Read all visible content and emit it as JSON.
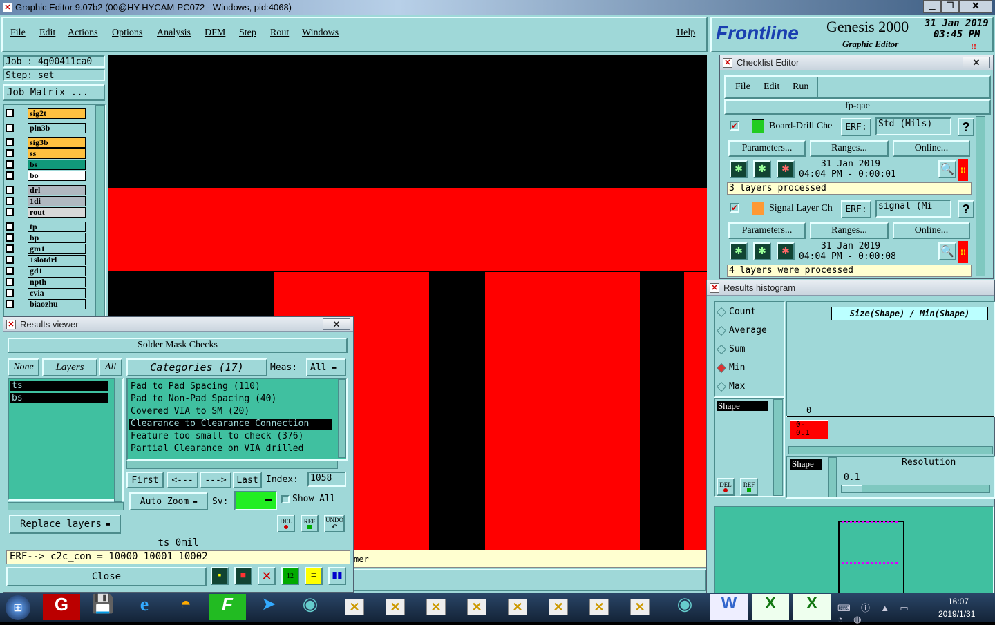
{
  "window": {
    "title": "Graphic Editor 9.07b2 (00@HY-HYCAM-PC072 - Windows, pid:4068)"
  },
  "menu": {
    "items": [
      "File",
      "Edit",
      "Actions",
      "Options",
      "Analysis",
      "DFM",
      "Step",
      "Rout",
      "Windows"
    ],
    "help": "Help"
  },
  "brand": {
    "logo": "Frontline",
    "product": "Genesis 2000",
    "subtitle": "Graphic Editor",
    "date": "31 Jan 2019",
    "time": "03:45 PM"
  },
  "job": {
    "job_label": "Job  : 4g00411ca0",
    "step_label": "Step: set",
    "matrix_button": "Job Matrix ..."
  },
  "layers": [
    {
      "name": "sig2t",
      "color": "#ffc040"
    },
    {
      "name": "pln3b",
      "color": "#9fd8d8"
    },
    {
      "name": "sig3b",
      "color": "#ffc040"
    },
    {
      "name": "ss",
      "color": "#ffc040"
    },
    {
      "name": "bs",
      "color": "#11997a"
    },
    {
      "name": "bo",
      "color": "#ffffff"
    },
    {
      "name": "drl",
      "color": "#b0b8c0"
    },
    {
      "name": "1di",
      "color": "#b0b8c0"
    },
    {
      "name": "rout",
      "color": "#d8d8d8"
    },
    {
      "name": "tp",
      "color": "#9fd8d8"
    },
    {
      "name": "bp",
      "color": "#9fd8d8"
    },
    {
      "name": "gm1",
      "color": "#9fd8d8"
    },
    {
      "name": "1slotdrl",
      "color": "#9fd8d8"
    },
    {
      "name": "gd1",
      "color": "#9fd8d8"
    },
    {
      "name": "npth",
      "color": "#9fd8d8"
    },
    {
      "name": "cvia",
      "color": "#9fd8d8"
    },
    {
      "name": "biaozhu",
      "color": "#9fd8d8"
    }
  ],
  "checklist": {
    "title": "Checklist Editor",
    "menu": [
      "File",
      "Edit",
      "Run"
    ],
    "name": "fp-qae",
    "checks": [
      {
        "name": "Board-Drill Che",
        "erf_label": "ERF:",
        "erf_value": "Std (Mils)",
        "help": "?",
        "params": "Parameters...",
        "ranges": "Ranges...",
        "online": "Online...",
        "date": "31 Jan 2019",
        "time": "04:04 PM - 0:00:01",
        "status": "3 layers processed"
      },
      {
        "name": "Signal Layer Ch",
        "erf_label": "ERF:",
        "erf_value": "signal (Mi",
        "help": "?",
        "params": "Parameters...",
        "ranges": "Ranges...",
        "online": "Online...",
        "date": "31 Jan 2019",
        "time": "04:04 PM - 0:00:08",
        "status": "4 layers were processed"
      }
    ]
  },
  "histogram": {
    "title": "Results histogram",
    "options": [
      "Count",
      "Average",
      "Sum",
      "Min",
      "Max"
    ],
    "selected": "Min",
    "header": "Size(Shape) / Min(Shape)",
    "zero": "0",
    "bin_label": "0-\n0.1",
    "list_item": "Shape",
    "shape_label": "Shape",
    "resolution_label": "Resolution",
    "resolution_value": "0.1",
    "del": "DEL",
    "ref": "REF"
  },
  "results": {
    "title": "Results viewer",
    "header": "Solder Mask Checks",
    "none_btn": "None",
    "layers_btn": "Layers",
    "all_btn": "All",
    "layers": [
      "ts",
      "bs"
    ],
    "categories_btn": "Categories (17)",
    "meas_label": "Meas:",
    "meas_value": "All",
    "categories": [
      "Pad to Pad Spacing (110)",
      "Pad to Non-Pad Spacing (40)",
      "Covered VIA to SM (20)",
      "Clearance to Clearance Connection",
      "Feature too small to check (376)",
      "Partial Clearance on VIA drilled"
    ],
    "selected_category": 3,
    "first": "First",
    "prev": "<---",
    "next": "--->",
    "last": "Last",
    "index_label": "Index:",
    "index_value": "1058",
    "zoom": "Auto Zoom",
    "sv_label": "Sv:",
    "show_all": "Show All",
    "replace": "Replace layers",
    "del": "DEL",
    "ref": "REF",
    "undo": "UNDO",
    "status": "ts 0mil",
    "erf": "ERF--> c2c_con = 10000 10001 10002",
    "close": "Close"
  },
  "canvas_status": "mer",
  "taskbar": {
    "time": "16:07",
    "date": "2019/1/31"
  }
}
